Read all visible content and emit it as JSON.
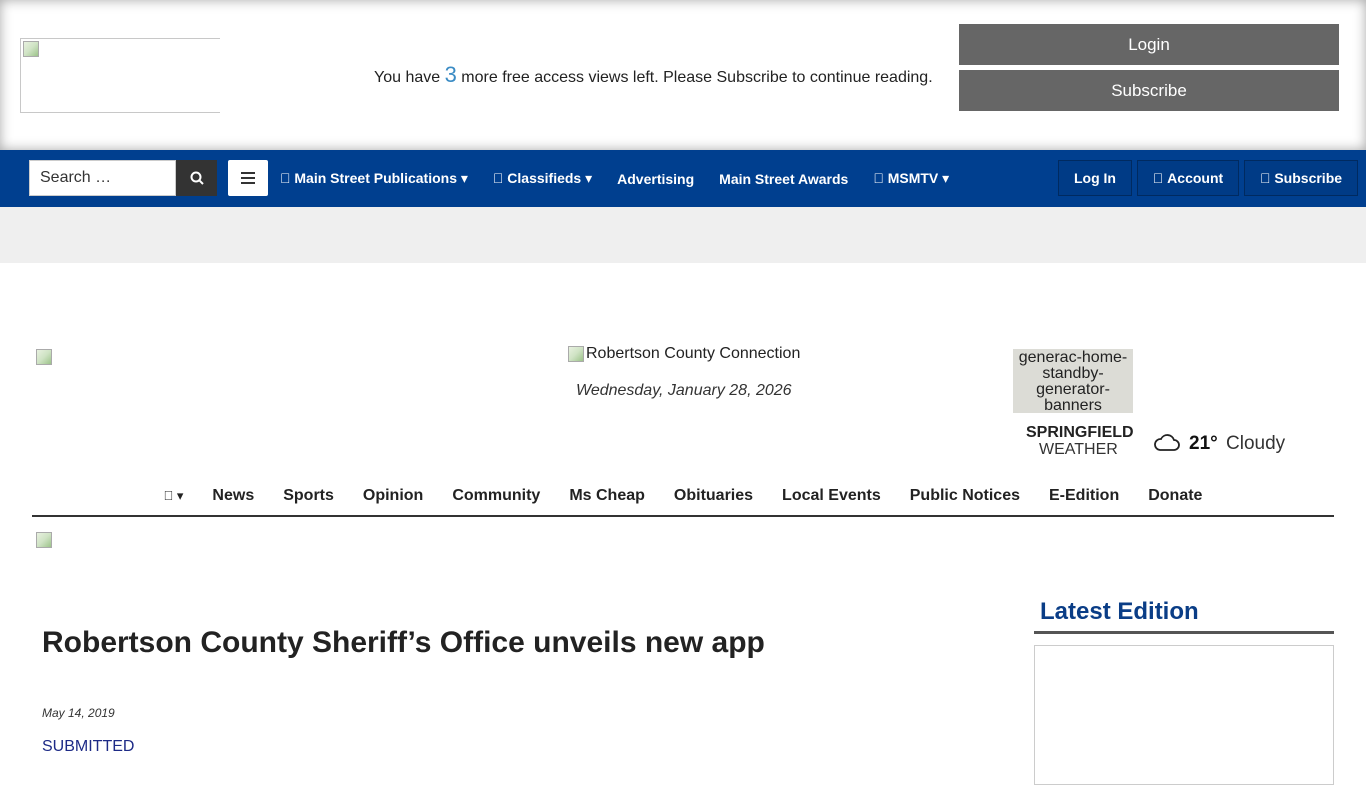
{
  "paywall": {
    "msg_before": "You have ",
    "count": "3",
    "msg_after": " more free access views left. Please Subscribe to continue reading.",
    "login_label": "Login",
    "subscribe_label": "Subscribe"
  },
  "topnav": {
    "search_placeholder": "Search …",
    "search_icon": "search-icon",
    "menu_icon": "hamburger-icon",
    "links": [
      {
        "label": " Main Street Publications ▾"
      },
      {
        "label": " Classifieds ▾"
      },
      {
        "label": "Advertising"
      },
      {
        "label": "Main Street Awards"
      },
      {
        "label": " MSMTV ▾"
      }
    ],
    "login_label": "Log In",
    "account_label": " Account",
    "subscribe_label": " Subscribe"
  },
  "masthead": {
    "logo_alt": "Robertson County Connection",
    "date": "Wednesday, January 28, 2026",
    "ad_alt": "generac-home-standby-generator-banners"
  },
  "weather": {
    "city": "SPRINGFIELD",
    "label": "WEATHER",
    "temp": "21°",
    "condition": "Cloudy",
    "icon": "cloud-icon"
  },
  "mainnav": {
    "home_label": " ▾",
    "items": [
      "News",
      "Sports",
      "Opinion",
      "Community",
      "Ms Cheap",
      "Obituaries",
      "Local Events",
      "Public Notices",
      "E-Edition",
      "Donate"
    ]
  },
  "article": {
    "title": "Robertson County Sheriff’s Office unveils new app",
    "date": "May 14, 2019",
    "byline": "SUBMITTED"
  },
  "sidebar": {
    "title": "Latest Edition"
  },
  "colors": {
    "nav_blue": "#003f8f",
    "paywall_button": "#666666",
    "sidebar_title": "#0a3d86"
  }
}
